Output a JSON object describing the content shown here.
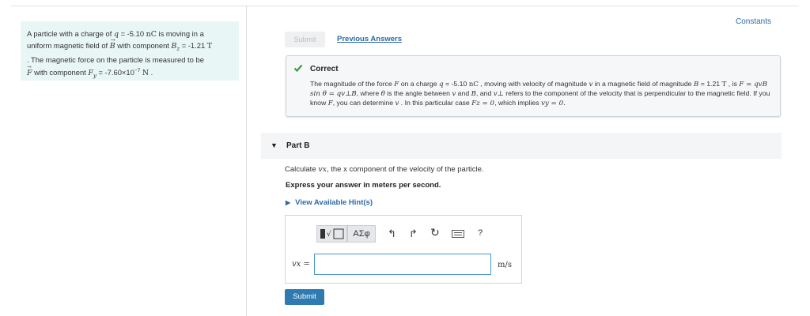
{
  "problem": {
    "line1_pre": "A particle with a charge of ",
    "q_sym": "q",
    "q_val": " = -5.10 ",
    "q_unit": "nC",
    "line1_post": " is moving in a",
    "line2_pre": "uniform magnetic field of ",
    "B_sym": "B",
    "line2_mid": " with component ",
    "Bz_sym": "B",
    "Bz_sub": "z",
    "Bz_val": " = -1.21 ",
    "Bz_unit": "T",
    "line3": ". The magnetic force on the particle is measured to be",
    "F_sym": "F",
    "line4_mid": " with component ",
    "Fy_sym": "F",
    "Fy_sub": "y",
    "Fy_val": " = -7.60×10",
    "Fy_exp": "−7",
    "Fy_unit": "N",
    "Fy_end": " ."
  },
  "constants_label": "Constants",
  "top_submit_label": "Submit",
  "previous_answers_label": "Previous Answers",
  "feedback": {
    "title": "Correct",
    "t1": "The magnitude of the force ",
    "t2": " on a charge ",
    "t3": " = -5.10 ",
    "t4": " , moving with velocity of magnitude ",
    "t5": " in a magnetic field of magnitude ",
    "t6": " = 1.21",
    "t7": " , is ",
    "t8": ", where ",
    "t9": " is the angle between ",
    "t10": " and ",
    "t11": ", and ",
    "t12": " refers to the component of the velocity that  is",
    "t13": "perpendicular to the magnetic field. If you know ",
    "t14": ", you can determine ",
    "t15": " . In this particular case ",
    "t16": ", which implies ",
    "sym_F": "F",
    "sym_q": "q",
    "sym_nC": "nC",
    "sym_v": "v",
    "sym_B": "B",
    "sym_T": "T",
    "eq_force": "F = qvB sin θ = qv⊥B",
    "sym_theta": "θ",
    "sym_vperp": "v⊥",
    "eq_fz": "Fz = 0",
    "eq_vy": "vy = 0."
  },
  "part_b": {
    "title": "Part B",
    "q_pre": "Calculate ",
    "q_sym": "vx",
    "q_post": ", the x component of the velocity of the particle.",
    "express": "Express your answer in meters per second.",
    "hints_label": "View Available Hint(s)"
  },
  "answer": {
    "var_label": "vx =",
    "value": "",
    "unit": "m/s",
    "greek_label": "ΑΣφ",
    "undo_icon": "↰",
    "redo_icon": "↱",
    "reset_icon": "↻",
    "help_icon": "?"
  },
  "submit_label": "Submit"
}
